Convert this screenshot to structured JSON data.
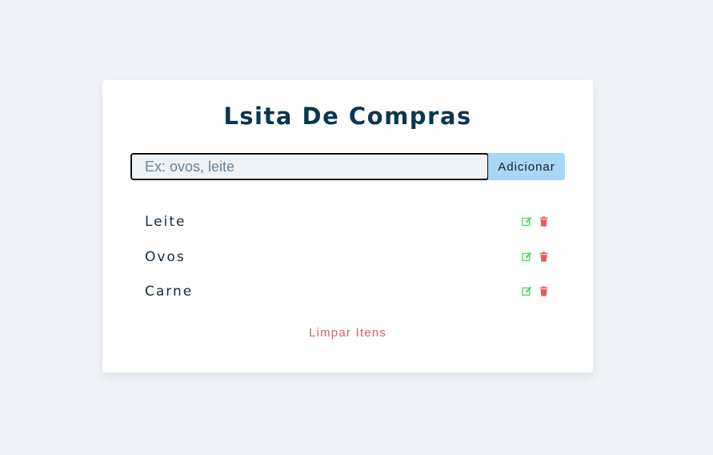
{
  "app": {
    "title": "Lsita De Compras"
  },
  "form": {
    "input_value": "",
    "input_placeholder": "Ex: ovos, leite",
    "add_label": "Adicionar"
  },
  "items": [
    {
      "name": "Leite",
      "edit_icon": "edit-icon",
      "delete_icon": "trash-icon"
    },
    {
      "name": "Ovos",
      "edit_icon": "edit-icon",
      "delete_icon": "trash-icon"
    },
    {
      "name": "Carne",
      "edit_icon": "edit-icon",
      "delete_icon": "trash-icon"
    }
  ],
  "footer": {
    "clear_label": "Limpar Itens"
  },
  "colors": {
    "background": "#f0f4f8",
    "title": "#0b3652",
    "button_bg": "#a8d6f5",
    "edit": "#4cd964",
    "delete": "#e35d5d"
  }
}
